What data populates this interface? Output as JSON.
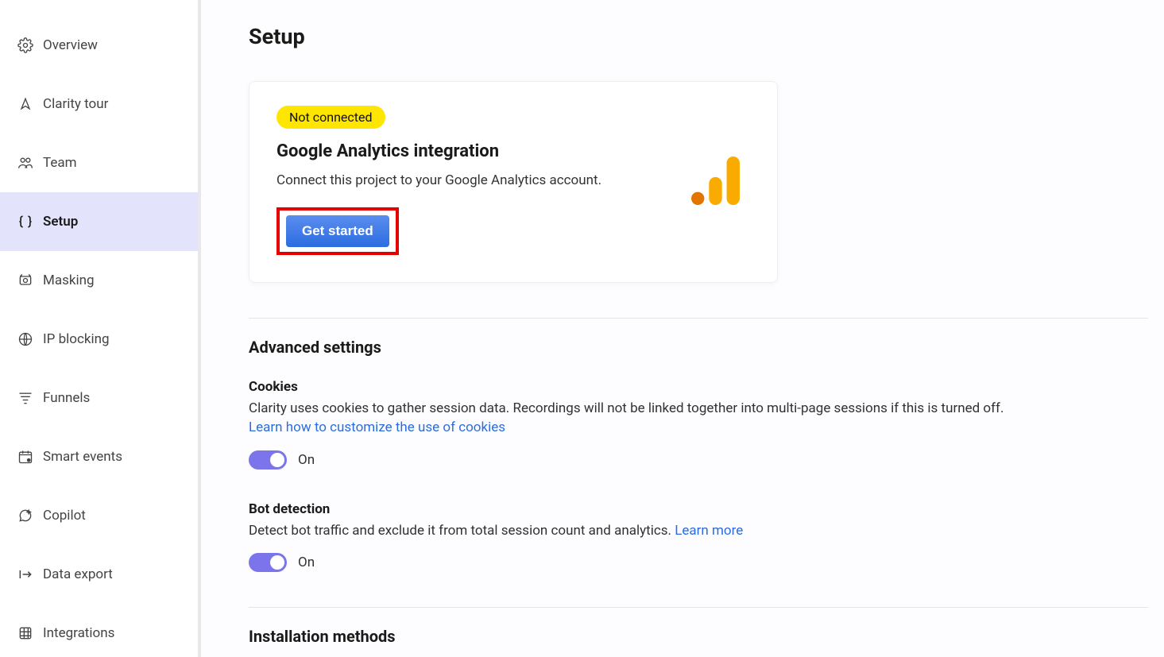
{
  "sidebar": {
    "items": [
      {
        "label": "Overview"
      },
      {
        "label": "Clarity tour"
      },
      {
        "label": "Team"
      },
      {
        "label": "Setup"
      },
      {
        "label": "Masking"
      },
      {
        "label": "IP blocking"
      },
      {
        "label": "Funnels"
      },
      {
        "label": "Smart events"
      },
      {
        "label": "Copilot"
      },
      {
        "label": "Data export"
      },
      {
        "label": "Integrations"
      }
    ]
  },
  "page": {
    "title": "Setup"
  },
  "card": {
    "badge": "Not connected",
    "title": "Google Analytics integration",
    "description": "Connect this project to your Google Analytics account.",
    "cta": "Get started"
  },
  "advanced": {
    "title": "Advanced settings",
    "cookies": {
      "label": "Cookies",
      "description": "Clarity uses cookies to gather session data. Recordings will not be linked together into multi-page sessions if this is turned off.",
      "link": "Learn how to customize the use of cookies",
      "state": "On"
    },
    "bot": {
      "label": "Bot detection",
      "description": "Detect bot traffic and exclude it from total session count and analytics. ",
      "link": "Learn more",
      "state": "On"
    }
  },
  "installation": {
    "title": "Installation methods"
  }
}
